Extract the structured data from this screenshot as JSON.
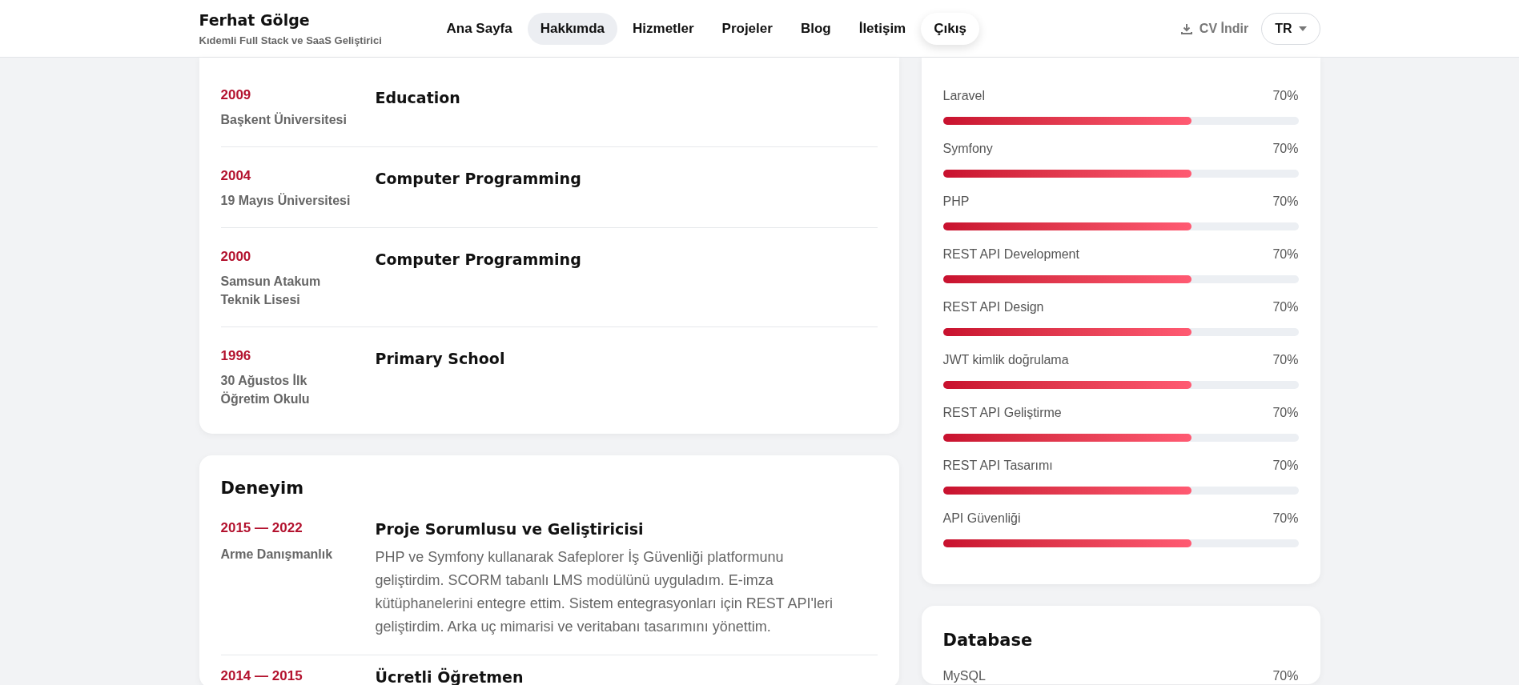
{
  "brand": {
    "name": "Ferhat Gölge",
    "tagline": "Kıdemli Full Stack ve SaaS Geliştirici"
  },
  "nav": [
    {
      "label": "Ana Sayfa",
      "selected": false,
      "kind": "link"
    },
    {
      "label": "Hakkımda",
      "selected": true,
      "kind": "link"
    },
    {
      "label": "Hizmetler",
      "selected": false,
      "kind": "link"
    },
    {
      "label": "Projeler",
      "selected": false,
      "kind": "link"
    },
    {
      "label": "Blog",
      "selected": false,
      "kind": "link"
    },
    {
      "label": "İletişim",
      "selected": false,
      "kind": "link"
    },
    {
      "label": "Çıkış",
      "selected": false,
      "kind": "raised"
    }
  ],
  "cv_button": "CV İndir",
  "language": "TR",
  "education": [
    {
      "year": "2009",
      "school": "Başkent Üniversitesi",
      "title": "Education"
    },
    {
      "year": "2004",
      "school": "19 Mayıs Üniversitesi",
      "title": "Computer Programming"
    },
    {
      "year": "2000",
      "school": "Samsun Atakum Teknik Lisesi",
      "title": "Computer Programming"
    },
    {
      "year": "1996",
      "school": "30 Ağustos İlk Öğretim Okulu",
      "title": "Primary School"
    }
  ],
  "experience": {
    "title": "Deneyim",
    "items": [
      {
        "period": "2015 — 2022",
        "company": "Arme Danışmanlık",
        "title": "Proje Sorumlusu ve Geliştiricisi",
        "description": "PHP ve Symfony kullanarak Safeplorer İş Güvenliği platformunu geliştirdim. SCORM tabanlı LMS modülünü uyguladım. E-imza kütüphanelerini entegre ettim. Sistem entegrasyonları için REST API'leri geliştirdim. Arka uç mimarisi ve veritabanı tasarımını yönettim."
      },
      {
        "period": "2014 — 2015",
        "title": "Ücretli Öğretmen"
      }
    ]
  },
  "backend": [
    {
      "name": "Laravel",
      "reading": "70%",
      "level": 0.7
    },
    {
      "name": "Symfony",
      "reading": "70%",
      "level": 0.7
    },
    {
      "name": "PHP",
      "reading": "70%",
      "level": 0.7
    },
    {
      "name": "REST API Development",
      "reading": "70%",
      "level": 0.7
    },
    {
      "name": "REST API Design",
      "reading": "70%",
      "level": 0.7
    },
    {
      "name": "JWT kimlik doğrulama",
      "reading": "70%",
      "level": 0.7
    },
    {
      "name": "REST API Geliştirme",
      "reading": "70%",
      "level": 0.7
    },
    {
      "name": "REST API Tasarımı",
      "reading": "70%",
      "level": 0.7
    },
    {
      "name": "API Güvenliği",
      "reading": "70%",
      "level": 0.7
    }
  ],
  "database": {
    "title": "Database",
    "items": [
      {
        "name": "MySQL",
        "reading": "70%"
      }
    ]
  }
}
